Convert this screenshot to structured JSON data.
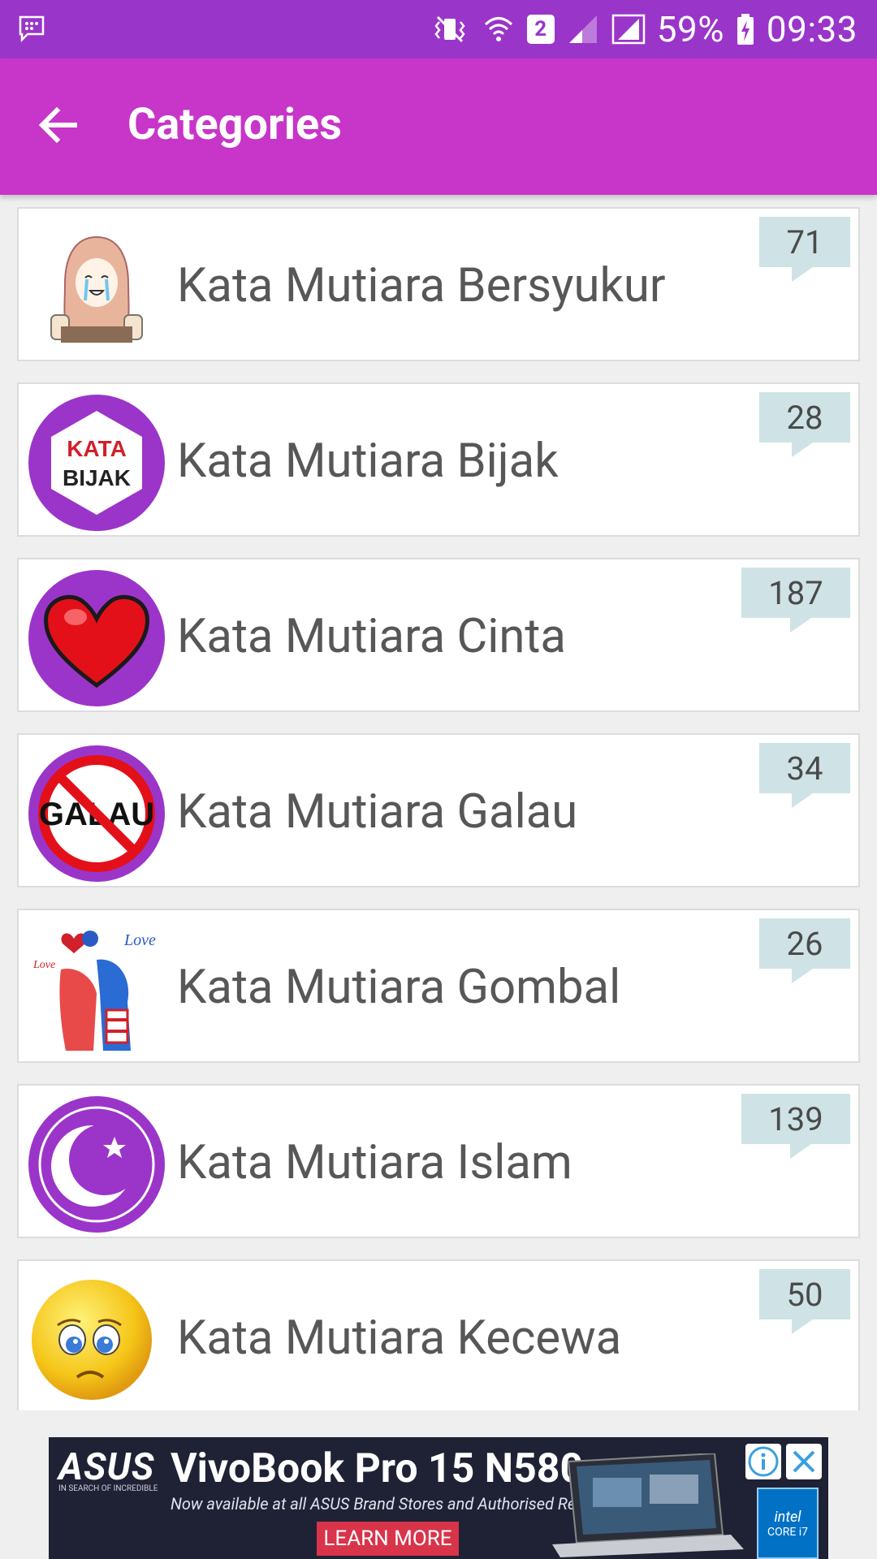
{
  "status_bar": {
    "battery": "59%",
    "time": "09:33",
    "sim_badge": "2"
  },
  "app_bar": {
    "title": "Categories"
  },
  "categories": [
    {
      "label": "Kata Mutiara Bersyukur",
      "count": "71"
    },
    {
      "label": "Kata Mutiara Bijak",
      "count": "28"
    },
    {
      "label": "Kata Mutiara Cinta",
      "count": "187"
    },
    {
      "label": "Kata Mutiara Galau",
      "count": "34"
    },
    {
      "label": "Kata Mutiara Gombal",
      "count": "26"
    },
    {
      "label": "Kata Mutiara Islam",
      "count": "139"
    },
    {
      "label": "Kata Mutiara Kecewa",
      "count": "50"
    }
  ],
  "icons": {
    "bijak_line1": "KATA",
    "bijak_line2": "BIJAK",
    "galau_text": "GALAU",
    "love_text": "Love"
  },
  "ad": {
    "brand": "ASUS",
    "brand_sub": "IN SEARCH OF INCREDIBLE",
    "headline": "VivoBook Pro 15 N580",
    "subline": "Now available at all ASUS Brand Stores and Authorised Retailers",
    "cta": "LEARN MORE",
    "intel_line1": "intel",
    "intel_line2": "CORE i7"
  },
  "colors": {
    "status_bar": "#9a35c9",
    "app_bar": "#c735c9",
    "icon_purple": "#9b35c9",
    "badge_bg": "#cfe3e6"
  }
}
